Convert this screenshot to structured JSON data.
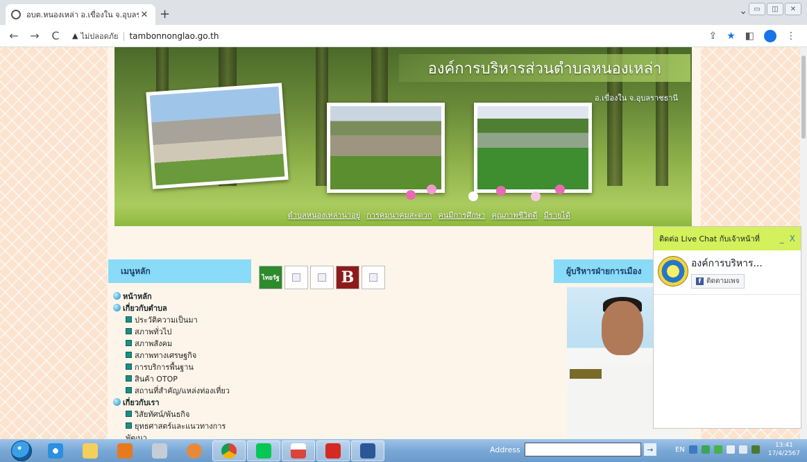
{
  "browser": {
    "tab_title": "อบต.หนองเหล่า อ.เขื่องใน จ.อุบลราชธ",
    "close_glyph": "✕",
    "new_tab_glyph": "+",
    "tab_dropdown_glyph": "⌄",
    "insecure_label": "ไม่ปลอดภัย",
    "url": "tambonnonglao.go.th",
    "back_glyph": "←",
    "forward_glyph": "→",
    "reload_glyph": "C",
    "warn_glyph": "▲",
    "share_glyph": "⇪",
    "star_glyph": "★",
    "sidepanel_glyph": "◧",
    "menu_glyph": "⋮",
    "window_controls": [
      "▭",
      "◫",
      "✕"
    ]
  },
  "site": {
    "title": "องค์การบริหารส่วนตำบลหนองเหล่า",
    "subtitle": "อ.เขื่องใน  จ.อุบลราชธานี",
    "nav": [
      "ตำบลหนองเหล่าน่าอยู่",
      "การคมนาคมสะดวก",
      "คนมีการศึกษา",
      "คุณภาพชีวิตดี",
      "มีรายได้"
    ]
  },
  "menu": {
    "heading": "เมนูหลัก",
    "items": [
      {
        "level": 1,
        "label": "หน้าหลัก"
      },
      {
        "level": 1,
        "label": "เกี่ยวกับตำบล"
      },
      {
        "level": 2,
        "label": "ประวัติความเป็นมา"
      },
      {
        "level": 2,
        "label": "สภาพทั่วไป"
      },
      {
        "level": 2,
        "label": "สภาพสังคม"
      },
      {
        "level": 2,
        "label": "สภาพทางเศรษฐกิจ"
      },
      {
        "level": 2,
        "label": "การบริการพื้นฐาน"
      },
      {
        "level": 2,
        "label": "สินค้า OTOP"
      },
      {
        "level": 2,
        "label": "สถานที่สำคัญ/แหล่งท่องเที่ยว"
      },
      {
        "level": 1,
        "label": "เกี่ยวกับเรา"
      },
      {
        "level": 2,
        "label": "วิสัยทัศน์/พันธกิจ"
      },
      {
        "level": 2,
        "label": "ยุทธศาสตร์และแนวทางการ"
      },
      {
        "level": 2,
        "label": "พัฒนา"
      }
    ]
  },
  "links": {
    "thairath": "ไทยรัฐ",
    "blogo": "B"
  },
  "executive": {
    "heading": "ผู้บริหารฝ่ายการเมือง"
  },
  "chat": {
    "heading": "ติดต่อ Live Chat กับเจ้าหน้าที่",
    "minimize": "_",
    "close": "X",
    "page_name": "องค์การบริหาร...",
    "follow": "ติดตามเพจ",
    "fb_glyph": "f"
  },
  "taskbar": {
    "address_label": "Address",
    "go_glyph": "→",
    "lang": "EN",
    "time": "13:41",
    "date": "17/4/2567"
  },
  "colors": {
    "menu_header": "#89dbf7",
    "chat_header": "#d4f05b",
    "fb_blue": "#3b5998"
  }
}
